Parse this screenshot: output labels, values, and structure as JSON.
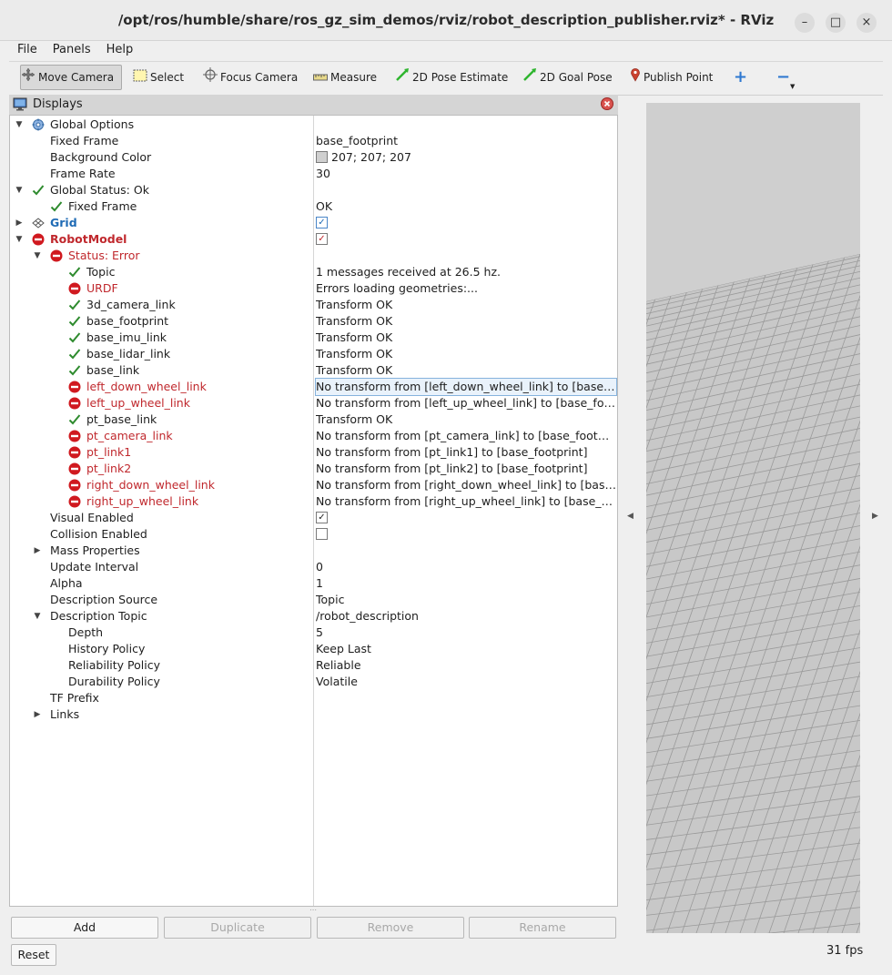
{
  "window": {
    "title": "/opt/ros/humble/share/ros_gz_sim_demos/rviz/robot_description_publisher.rviz* - RViz",
    "minimize": "–",
    "maximize": "□",
    "close": "×"
  },
  "menu": [
    "File",
    "Panels",
    "Help"
  ],
  "toolbar": {
    "move_camera": "Move Camera",
    "select": "Select",
    "focus_camera": "Focus Camera",
    "measure": "Measure",
    "pose_estimate": "2D Pose Estimate",
    "goal_pose": "2D Goal Pose",
    "publish_point": "Publish Point",
    "add": "+",
    "remove": "−"
  },
  "displays": {
    "title": "Displays",
    "rows": [
      {
        "name": "Global Options",
        "value": "",
        "indent": 1,
        "arrow": "down",
        "icon": "gear",
        "style": ""
      },
      {
        "name": "Fixed Frame",
        "value": "base_footprint",
        "indent": 2,
        "arrow": "",
        "icon": "",
        "style": ""
      },
      {
        "name": "Background Color",
        "value": "207; 207; 207",
        "indent": 2,
        "arrow": "",
        "icon": "",
        "style": "",
        "swatch": true
      },
      {
        "name": "Frame Rate",
        "value": "30",
        "indent": 2,
        "arrow": "",
        "icon": "",
        "style": ""
      },
      {
        "name": "Global Status: Ok",
        "value": "",
        "indent": 1,
        "arrow": "down",
        "icon": "check",
        "style": ""
      },
      {
        "name": "Fixed Frame",
        "value": "OK",
        "indent": 2,
        "arrow": "",
        "icon": "check",
        "style": ""
      },
      {
        "name": "Grid",
        "value": "",
        "indent": 1,
        "arrow": "right",
        "icon": "grid",
        "style": "blue",
        "checkbox": "blue"
      },
      {
        "name": "RobotModel",
        "value": "",
        "indent": 1,
        "arrow": "down",
        "icon": "error",
        "style": "errbold",
        "checkbox": "red"
      },
      {
        "name": "Status: Error",
        "value": "",
        "indent": 2,
        "arrow": "down",
        "icon": "error",
        "style": "err"
      },
      {
        "name": "Topic",
        "value": "1 messages received at 26.5 hz.",
        "indent": 3,
        "arrow": "",
        "icon": "check",
        "style": ""
      },
      {
        "name": "URDF",
        "value": "Errors loading geometries:...",
        "indent": 3,
        "arrow": "",
        "icon": "error",
        "style": "err"
      },
      {
        "name": "3d_camera_link",
        "value": "Transform OK",
        "indent": 3,
        "arrow": "",
        "icon": "check",
        "style": ""
      },
      {
        "name": "base_footprint",
        "value": "Transform OK",
        "indent": 3,
        "arrow": "",
        "icon": "check",
        "style": ""
      },
      {
        "name": "base_imu_link",
        "value": "Transform OK",
        "indent": 3,
        "arrow": "",
        "icon": "check",
        "style": ""
      },
      {
        "name": "base_lidar_link",
        "value": "Transform OK",
        "indent": 3,
        "arrow": "",
        "icon": "check",
        "style": ""
      },
      {
        "name": "base_link",
        "value": "Transform OK",
        "indent": 3,
        "arrow": "",
        "icon": "check",
        "style": ""
      },
      {
        "name": "left_down_wheel_link",
        "value": "No transform from [left_down_wheel_link] to [base_f...",
        "indent": 3,
        "arrow": "",
        "icon": "error",
        "style": "err",
        "selected": true
      },
      {
        "name": "left_up_wheel_link",
        "value": "No transform from [left_up_wheel_link] to [base_foot...",
        "indent": 3,
        "arrow": "",
        "icon": "error",
        "style": "err"
      },
      {
        "name": "pt_base_link",
        "value": "Transform OK",
        "indent": 3,
        "arrow": "",
        "icon": "check",
        "style": ""
      },
      {
        "name": "pt_camera_link",
        "value": "No transform from [pt_camera_link] to [base_footpri...",
        "indent": 3,
        "arrow": "",
        "icon": "error",
        "style": "err"
      },
      {
        "name": "pt_link1",
        "value": "No transform from [pt_link1] to [base_footprint]",
        "indent": 3,
        "arrow": "",
        "icon": "error",
        "style": "err"
      },
      {
        "name": "pt_link2",
        "value": "No transform from [pt_link2] to [base_footprint]",
        "indent": 3,
        "arrow": "",
        "icon": "error",
        "style": "err"
      },
      {
        "name": "right_down_wheel_link",
        "value": "No transform from [right_down_wheel_link] to [base...",
        "indent": 3,
        "arrow": "",
        "icon": "error",
        "style": "err"
      },
      {
        "name": "right_up_wheel_link",
        "value": "No transform from [right_up_wheel_link] to [base_fo...",
        "indent": 3,
        "arrow": "",
        "icon": "error",
        "style": "err"
      },
      {
        "name": "Visual Enabled",
        "value": "",
        "indent": 2,
        "arrow": "",
        "icon": "",
        "style": "",
        "checkbox": "checked"
      },
      {
        "name": "Collision Enabled",
        "value": "",
        "indent": 2,
        "arrow": "",
        "icon": "",
        "style": "",
        "checkbox": "empty"
      },
      {
        "name": "Mass Properties",
        "value": "",
        "indent": 2,
        "arrow": "right",
        "icon": "",
        "style": ""
      },
      {
        "name": "Update Interval",
        "value": "0",
        "indent": 2,
        "arrow": "",
        "icon": "",
        "style": ""
      },
      {
        "name": "Alpha",
        "value": "1",
        "indent": 2,
        "arrow": "",
        "icon": "",
        "style": ""
      },
      {
        "name": "Description Source",
        "value": "Topic",
        "indent": 2,
        "arrow": "",
        "icon": "",
        "style": ""
      },
      {
        "name": "Description Topic",
        "value": "/robot_description",
        "indent": 2,
        "arrow": "down",
        "icon": "",
        "style": ""
      },
      {
        "name": "Depth",
        "value": "5",
        "indent": 3,
        "arrow": "",
        "icon": "",
        "style": ""
      },
      {
        "name": "History Policy",
        "value": "Keep Last",
        "indent": 3,
        "arrow": "",
        "icon": "",
        "style": ""
      },
      {
        "name": "Reliability Policy",
        "value": "Reliable",
        "indent": 3,
        "arrow": "",
        "icon": "",
        "style": ""
      },
      {
        "name": "Durability Policy",
        "value": "Volatile",
        "indent": 3,
        "arrow": "",
        "icon": "",
        "style": ""
      },
      {
        "name": "TF Prefix",
        "value": "",
        "indent": 2,
        "arrow": "",
        "icon": "",
        "style": ""
      },
      {
        "name": "Links",
        "value": "",
        "indent": 2,
        "arrow": "right",
        "icon": "",
        "style": ""
      }
    ]
  },
  "buttons": {
    "add": "Add",
    "duplicate": "Duplicate",
    "remove": "Remove",
    "rename": "Rename",
    "reset": "Reset"
  },
  "status": {
    "fps": "31 fps"
  },
  "colors": {
    "error": "#c0282d",
    "ok": "#2e8b2e",
    "grid_bg": "#c8c8c8",
    "sky": "#cfcfcf"
  }
}
